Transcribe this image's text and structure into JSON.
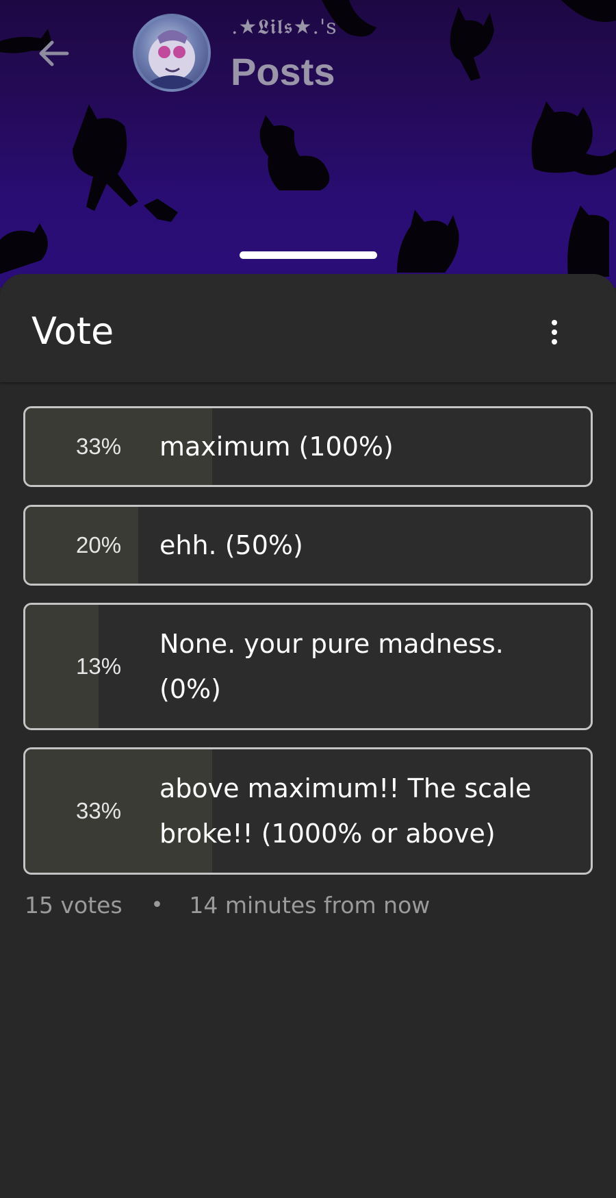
{
  "header": {
    "owner_name": ".★𝕷𝖎𝖑𝖘★.'s",
    "title": "Posts"
  },
  "poll": {
    "title": "Vote",
    "options": [
      {
        "percent_text": "33%",
        "percent": 33,
        "label": "maximum (100%)"
      },
      {
        "percent_text": "20%",
        "percent": 20,
        "label": "ehh. (50%)"
      },
      {
        "percent_text": "13%",
        "percent": 13,
        "label": "None. your pure madness. (0%)"
      },
      {
        "percent_text": "33%",
        "percent": 33,
        "label": "above maximum!! The scale broke!! (1000% or above)"
      }
    ],
    "votes": "15 votes",
    "separator": "•",
    "time_remaining": "14 minutes from now"
  },
  "icons": {
    "back": "arrow-left-icon",
    "more": "more-vertical-icon"
  },
  "colors": {
    "header_purple": "#3c12a6",
    "sheet_bg": "#282828",
    "option_border": "#c4c4c4",
    "result_fill": "#3b3b35",
    "muted_text": "#9b9b9b"
  }
}
